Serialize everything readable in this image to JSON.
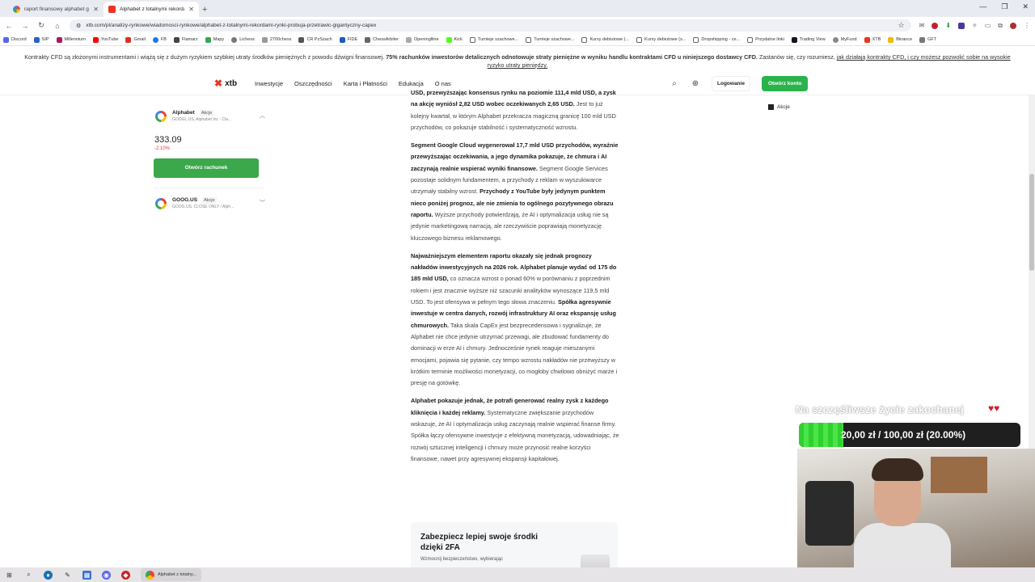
{
  "browser": {
    "tabs": [
      {
        "label": "raport finansowy alphabet goo",
        "active": false
      },
      {
        "label": "Alphabet z totalnymi rekordam",
        "active": true
      }
    ],
    "url": "xtb.com/pl/analizy-rynkowe/wiadomosci-rynkowe/alphabet-z-totalnymi-rekordami-rynki-probuja-przetrawic-gigantyczny-capex",
    "bookmarks": [
      "Discord",
      "SIP",
      "Millennium",
      "YouTube",
      "Gmail",
      "FB",
      "Flamarz",
      "Mapy",
      "Lichess",
      "2700chess",
      "CR PzSzach",
      "FIDE",
      "ChessArbiter",
      "Openinglline",
      "Kick",
      "Turnieje szachowe...",
      "Turnieje szachowe...",
      "Kursy debiutowe (...",
      "Kursy debiutowe (s...",
      "Dropshipping - ce...",
      "Przydatne linki",
      "Trading View",
      "MyFund",
      "XTB",
      "Binance",
      "GFT"
    ]
  },
  "cfd_banner": {
    "text1": "Kontrakty CFD są złożonymi instrumentami i wiążą się z dużym ryzykiem szybkiej utraty środków pieniężnych z powodu dźwigni finansowej.",
    "bold": "75% rachunków inwestorów detalicznych odnotowuje straty pieniężne w wyniku handlu kontraktami CFD u niniejszego dostawcy CFD.",
    "text2": "Zastanów się, czy rozumiesz,",
    "link": "jak działają kontrakty CFD, i czy możesz pozwolić sobie na wysokie ryzyko utraty pieniędzy."
  },
  "site_nav": {
    "logo": "xtb",
    "links": [
      "Inwestycje",
      "Oszczędności",
      "Karta i Płatności",
      "Edukacja",
      "O nas"
    ],
    "login": "Logowanie",
    "open_account": "Otwórz konto"
  },
  "widget": {
    "primary": {
      "name": "Alphabet",
      "tag": "Akcje",
      "sub": "GOOGL.US, Alphabet Inc - Cla...",
      "price": "333.09",
      "change": "-2.10%"
    },
    "open_button": "Otwórz rachunek",
    "secondary": {
      "name": "GOOG.US",
      "tag": "Akcje",
      "sub": "GOOG.US, CLOSE ONLY / Alph..."
    }
  },
  "side_tag": "Akcje",
  "article": {
    "p1_top": "USD, przewyższając konsensus rynku na poziomie 111,4 mld USD, a zysk na akcję wyniósł 2,82 USD wobec oczekiwanych 2,65 USD.",
    "p1_rest": "Jest to już kolejny kwartał, w którym Alphabet przekracza magiczną granicę 100 mld USD przychodów, co pokazuje stabilność i systematyczność wzrostu.",
    "p2_b1": "Segment Google Cloud wygenerował 17,7 mld USD przychodów, wyraźnie przewyższając oczekiwania, a jego dynamika pokazuje, że chmura i AI zaczynają realnie wspierać wyniki finansowe.",
    "p2_t1": "Segment Google Services pozostaje solidnym fundamentem, a przychody z reklam w wyszukiwarce utrzymały stabilny wzrost.",
    "p2_b2": "Przychody z YouTube były jedynym punktem nieco poniżej prognoz, ale nie zmienia to ogólnego pozytywnego obrazu raportu.",
    "p2_t2": "Wyższe przychody potwierdzają, że AI i optymalizacja usług nie są jedynie marketingową narracją, ale rzeczywiście poprawiają monetyzację kluczowego biznesu reklamowego.",
    "p3_b1": "Najważniejszym elementem raportu okazały się jednak prognozy nakładów inwestycyjnych na 2026 rok. Alphabet planuje wydać od 175 do 185 mld USD,",
    "p3_t1": "co oznacza wzrost o ponad 60% w porównaniu z poprzednim rokiem i jest znacznie wyższe niż szacunki analityków wynoszące 119,5 mld USD. To jest ofensywa w pełnym tego słowa znaczeniu.",
    "p3_b2": "Spółka agresywnie inwestuje w centra danych, rozwój infrastruktury AI oraz ekspansję usług chmurowych.",
    "p3_t2": "Taka skala CapEx jest bezprecedensowa i sygnalizuje, że Alphabet nie chce jedynie utrzymać przewagi, ale zbudować fundamenty do dominacji w erze AI i chmury. Jednocześnie rynek reaguje mieszanymi emocjami, pojawia się pytanie, czy tempo wzrostu nakładów nie przewyższy w krótkim terminie możliwości monetyzacji, co mogłoby chwilowo obniżyć marże i presję na gotówkę.",
    "p4_b1": "Alphabet pokazuje jednak, że potrafi generować realny zysk z każdego kliknięcia i każdej reklamy.",
    "p4_t1": "Systematyczne zwiększanie przychodów wskazuje, że AI i optymalizacja usług zaczynają realnie wspierać finanse firmy. Spółka łączy ofensywne inwestycje z efektywną monetyzacją, udowadniając, że rozwój sztucznej inteligencji i chmury może przynosić realne korzyści finansowe, nawet przy agresywnej ekspansji kapitałowej.",
    "card_title": "Zabezpiecz lepiej swoje środki dzięki 2FA",
    "card_sub": "Wzmocnij bezpieczeństwo, wybierając"
  },
  "overlay": {
    "caption": "Na szczęśliwsze życie zakochanej",
    "goal_text": "20,00 zł / 100,00 zł (20.00%)",
    "goal_fraction": 0.2
  },
  "taskbar": {
    "active_label": "Alphabet z totalny..."
  },
  "colors": {
    "accent_green": "#2bb34b",
    "negative_red": "#e23a3a",
    "xtb_red": "#ee3322"
  }
}
